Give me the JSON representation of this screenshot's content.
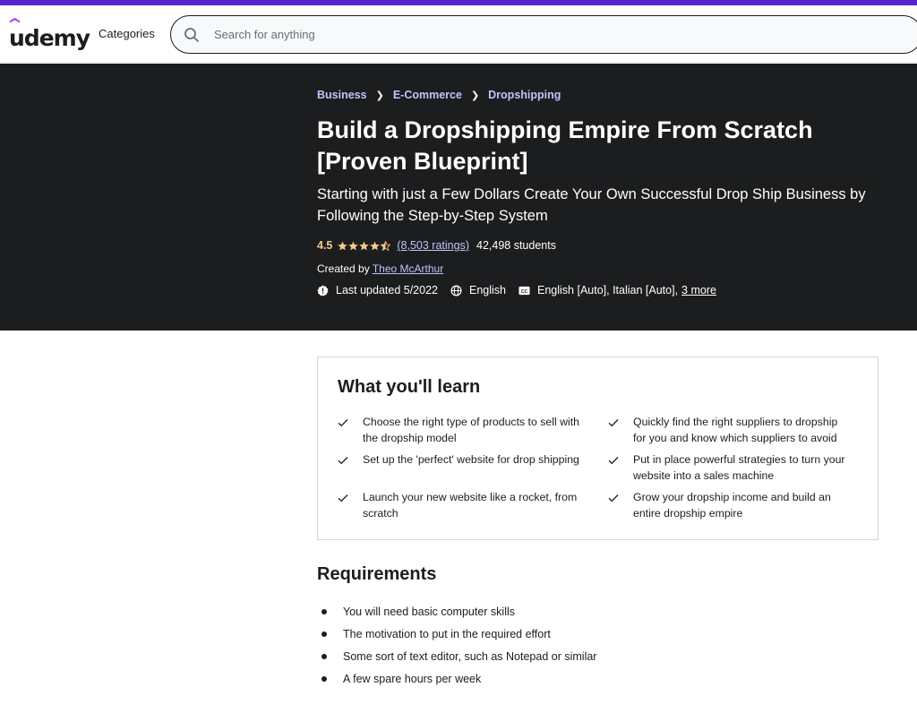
{
  "header": {
    "logo": "udemy",
    "categories_label": "Categories",
    "search_placeholder": "Search for anything"
  },
  "breadcrumb": [
    "Business",
    "E-Commerce",
    "Dropshipping"
  ],
  "course": {
    "title": "Build a Dropshipping Empire From Scratch [Proven Blueprint]",
    "subtitle": "Starting with just a Few Dollars Create Your Own Successful Drop Ship Business by Following the Step-by-Step System",
    "rating": "4.5",
    "rating_value": 4.5,
    "ratings_count": "(8,503 ratings)",
    "students": "42,498 students",
    "created_by_label": "Created by",
    "creator": "Theo McArthur",
    "last_updated": "Last updated 5/2022",
    "language": "English",
    "captions": "English [Auto], Italian [Auto],",
    "captions_more": "3 more"
  },
  "learn": {
    "heading": "What you'll learn",
    "items": [
      "Choose the right type of products to sell with the dropship model",
      "Quickly find the right suppliers to dropship for you and know which suppliers to avoid",
      "Set up the 'perfect' website for drop shipping",
      "Put in place powerful strategies to turn your website into a sales machine",
      "Launch your new website like a rocket, from scratch",
      "Grow your dropship income and build an entire dropship empire"
    ]
  },
  "requirements": {
    "heading": "Requirements",
    "items": [
      "You will need basic computer skills",
      "The motivation to put in the required effort",
      "Some sort of text editor, such as Notepad or similar",
      "A few spare hours per week"
    ]
  },
  "colors": {
    "brand": "#5624d0",
    "hero_bg": "#1c1d1f",
    "link_light": "#c0c4fc",
    "star": "#f3ca8c"
  }
}
